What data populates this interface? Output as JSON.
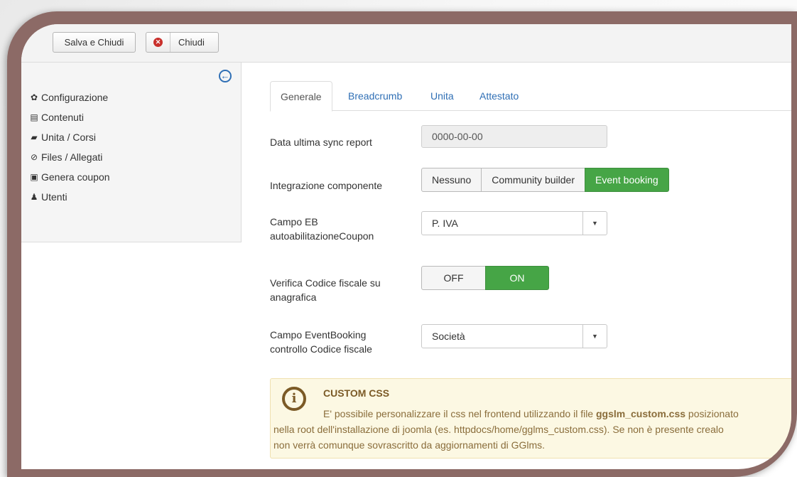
{
  "toolbar": {
    "save_close_label": "Salva e Chiudi",
    "close_label": "Chiudi"
  },
  "sidebar": {
    "items": [
      {
        "label": "Configurazione",
        "icon": "gear-icon"
      },
      {
        "label": "Contenuti",
        "icon": "document-icon"
      },
      {
        "label": "Unita / Corsi",
        "icon": "folder-icon"
      },
      {
        "label": "Files / Allegati",
        "icon": "paperclip-icon"
      },
      {
        "label": "Genera coupon",
        "icon": "print-icon"
      },
      {
        "label": "Utenti",
        "icon": "users-icon"
      }
    ]
  },
  "tabs": [
    "Generale",
    "Breadcrumb",
    "Unita",
    "Attestato"
  ],
  "form": {
    "sync": {
      "label": "Data ultima sync report",
      "value": "0000-00-00"
    },
    "integrazione": {
      "label": "Integrazione componente",
      "options": [
        "Nessuno",
        "Community builder",
        "Event booking"
      ],
      "selected": "Event booking"
    },
    "campo_eb": {
      "label_line1": "Campo EB",
      "label_line2": "autoabilitazioneCoupon",
      "value": "P. IVA"
    },
    "verifica": {
      "label_line1": "Verifica Codice fiscale su",
      "label_line2": "anagrafica",
      "off": "OFF",
      "on": "ON",
      "selected": "ON"
    },
    "campo_event": {
      "label_line1": "Campo EventBooking",
      "label_line2": "controllo Codice fiscale",
      "value": "Società"
    }
  },
  "alert": {
    "title": "CUSTOM CSS",
    "line1_before": "E' possibile personalizzare il css nel frontend utilizzando il file ",
    "line1_file": "ggslm_custom.css",
    "line1_after": " posizionato",
    "line2": "nella root dell'installazione di joomla (es. httpdocs/home/gglms_custom.css). Se non è presente crealo",
    "line3": "non verrà comunque sovrascritto da aggiornamenti di GGlms."
  },
  "colors": {
    "frame": "#8c6a66",
    "active_green": "#46a546",
    "link_blue": "#2f6fb5",
    "alert_bg": "#fcf8e3"
  }
}
